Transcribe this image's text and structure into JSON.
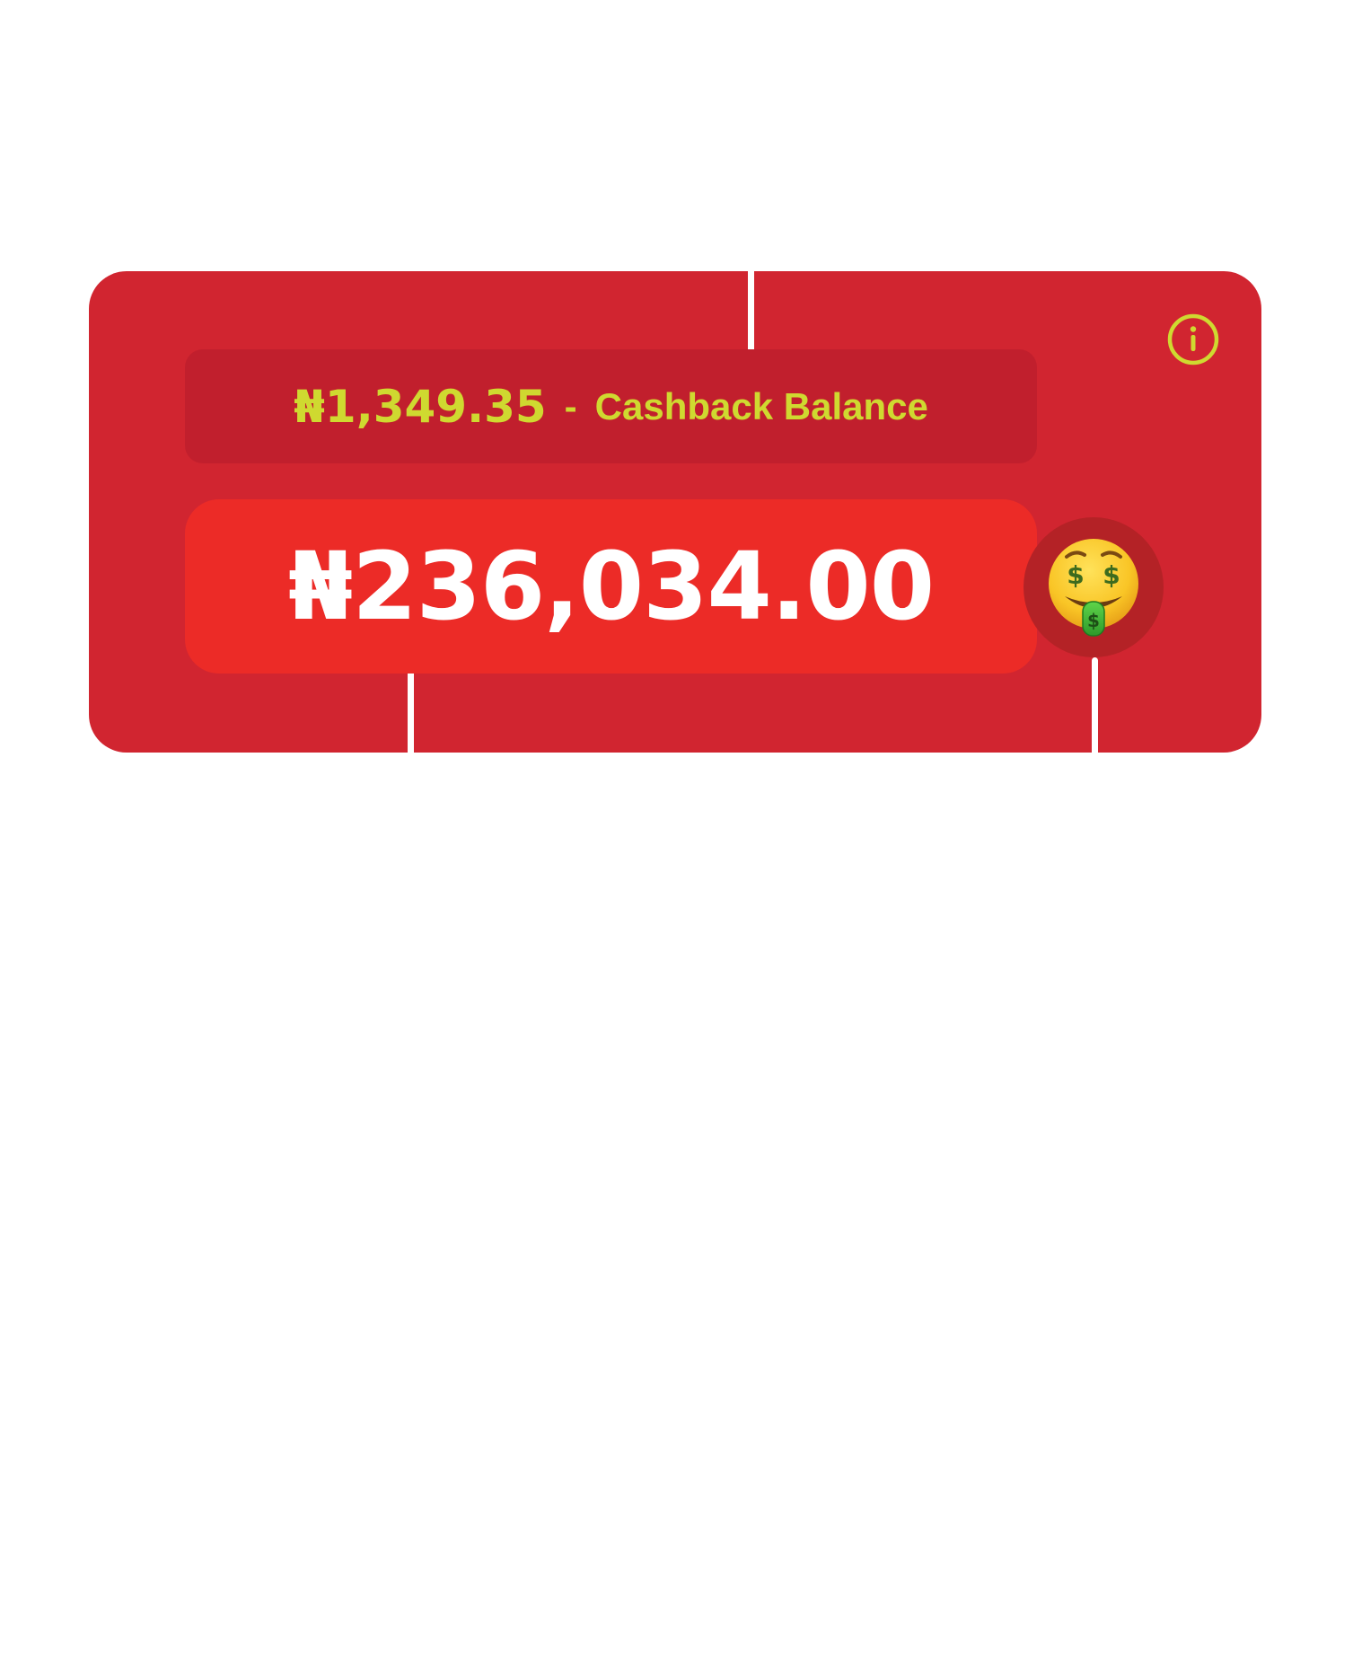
{
  "cashback": {
    "amount": "₦1,349.35",
    "separator": "-",
    "label": "Cashback Balance"
  },
  "balance": {
    "amount": "₦236,034.00"
  },
  "icons": {
    "info": "info-icon",
    "emoji": "money-mouth-face-icon"
  },
  "colors": {
    "card_background": "#d12530",
    "cashback_pill": "#c11f2d",
    "balance_pill": "#ec2b27",
    "accent_text": "#cfd930",
    "balance_text": "#ffffff"
  }
}
